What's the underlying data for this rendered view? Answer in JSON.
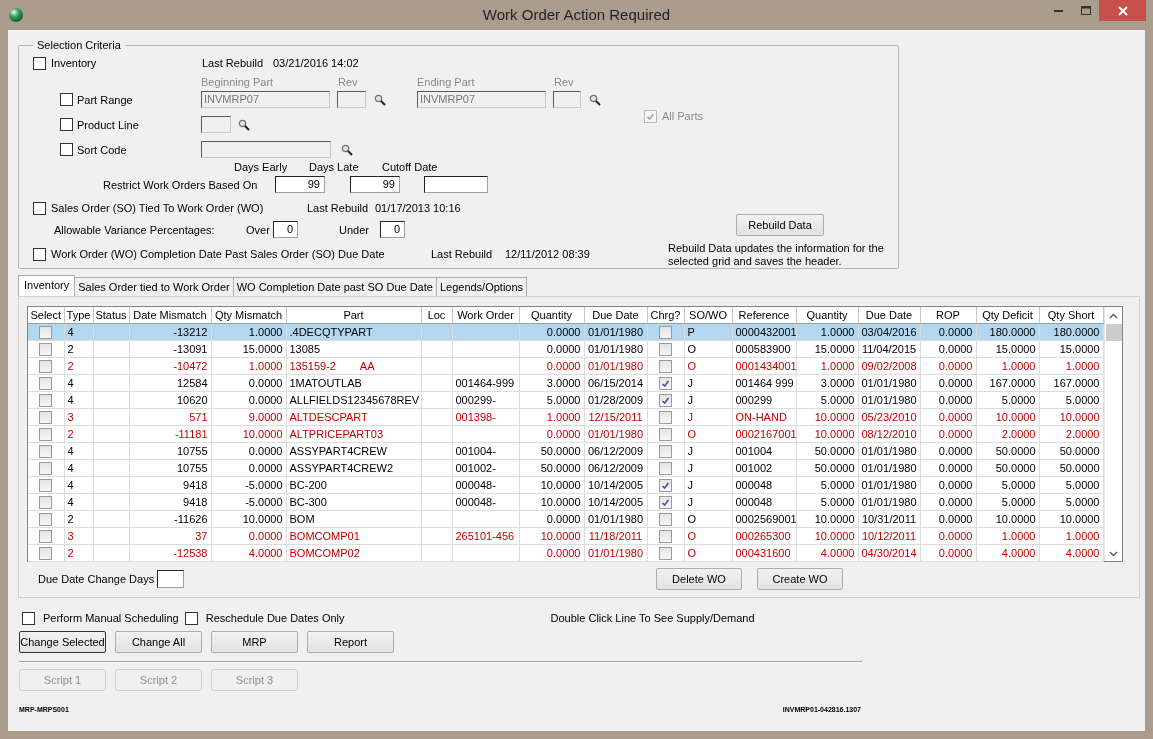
{
  "window": {
    "title": "Work Order Action Required"
  },
  "selection_criteria": {
    "title": "Selection Criteria",
    "inventory": {
      "label": "Inventory",
      "checked": false,
      "last_rebuild_label": "Last Rebuild",
      "last_rebuild": "03/21/2016 14:02"
    },
    "part_range": {
      "label": "Part Range",
      "checked": false,
      "disabled": true,
      "beginning_part_label": "Beginning Part",
      "beginning_part": "INVMRP07",
      "beginning_rev_label": "Rev",
      "ending_part_label": "Ending Part",
      "ending_part": "INVMRP07",
      "ending_rev_label": "Rev"
    },
    "all_parts": {
      "label": "All Parts",
      "checked": true,
      "disabled": true
    },
    "product_line": {
      "label": "Product Line",
      "checked": false
    },
    "sort_code": {
      "label": "Sort Code",
      "checked": false
    },
    "restrict": {
      "label": "Restrict Work Orders Based On",
      "days_early_label": "Days Early",
      "days_early": "99",
      "days_late_label": "Days Late",
      "days_late": "99",
      "cutoff_date_label": "Cutoff Date"
    },
    "sales_order": {
      "label": "Sales Order (SO) Tied To Work Order (WO)",
      "checked": false,
      "last_rebuild_label": "Last Rebuild",
      "last_rebuild": "01/17/2013 10:16"
    },
    "variance": {
      "label": "Allowable Variance Percentages:",
      "over_label": "Over",
      "over": "0",
      "under_label": "Under",
      "under": "0"
    },
    "completion": {
      "label": "Work Order (WO) Completion Date Past Sales Order (SO) Due Date",
      "checked": false,
      "last_rebuild_label": "Last Rebuild",
      "last_rebuild": "12/11/2012 08:39"
    },
    "rebuild_button": {
      "label": "Rebuild Data"
    },
    "rebuild_note": "Rebuild Data updates the information for the selected grid and saves the header."
  },
  "tabs": [
    {
      "label": "Inventory",
      "selected": true
    },
    {
      "label": "Sales Order tied to Work Order",
      "selected": false
    },
    {
      "label": "WO Completion Date past SO Due Date",
      "selected": false
    },
    {
      "label": "Legends/Options",
      "selected": false
    }
  ],
  "grid": {
    "columns": [
      {
        "label": "Select",
        "kind": "check"
      },
      {
        "label": "Type",
        "kind": "text"
      },
      {
        "label": "Status",
        "kind": "text"
      },
      {
        "label": "Date Mismatch",
        "kind": "number"
      },
      {
        "label": "Qty Mismatch",
        "kind": "number"
      },
      {
        "label": "Part",
        "kind": "text"
      },
      {
        "label": "Loc",
        "kind": "text"
      },
      {
        "label": "Work Order",
        "kind": "text"
      },
      {
        "label": "Quantity",
        "kind": "number"
      },
      {
        "label": "Due Date",
        "kind": "date"
      },
      {
        "label": "Chrg?",
        "kind": "check"
      },
      {
        "label": "SO/WO",
        "kind": "text"
      },
      {
        "label": "Reference",
        "kind": "text"
      },
      {
        "label": "Quantity",
        "kind": "number"
      },
      {
        "label": "Due Date",
        "kind": "date"
      },
      {
        "label": "ROP",
        "kind": "number"
      },
      {
        "label": "Qty Deficit",
        "kind": "number"
      },
      {
        "label": "Qty Short",
        "kind": "number"
      }
    ],
    "rows": [
      {
        "selected": true,
        "alert": false,
        "cells": [
          false,
          "4",
          "",
          "-13212",
          "1.0000",
          ".4DECQTYPART",
          "",
          "",
          "0.0000",
          "01/01/1980",
          false,
          "P",
          "0000432001",
          "1.0000",
          "03/04/2016",
          "0.0000",
          "180.0000",
          "180.0000"
        ]
      },
      {
        "selected": false,
        "alert": false,
        "cells": [
          false,
          "2",
          "",
          "-13091",
          "15.0000",
          "13085",
          "",
          "",
          "0.0000",
          "01/01/1980",
          false,
          "O",
          "000583900",
          "15.0000",
          "11/04/2015",
          "0.0000",
          "15.0000",
          "15.0000"
        ]
      },
      {
        "selected": false,
        "alert": true,
        "cells": [
          false,
          "2",
          "",
          "-10472",
          "1.0000",
          "135159-2        AA",
          "",
          "",
          "0.0000",
          "01/01/1980",
          false,
          "O",
          "0001434001",
          "1.0000",
          "09/02/2008",
          "0.0000",
          "1.0000",
          "1.0000"
        ]
      },
      {
        "selected": false,
        "alert": false,
        "cells": [
          false,
          "4",
          "",
          "12584",
          "0.0000",
          "1MATOUTLAB",
          "",
          "001464-999",
          "3.0000",
          "06/15/2014",
          true,
          "J",
          "001464 999",
          "3.0000",
          "01/01/1980",
          "0.0000",
          "167.0000",
          "167.0000"
        ]
      },
      {
        "selected": false,
        "alert": false,
        "cells": [
          false,
          "4",
          "",
          "10620",
          "0.0000",
          "ALLFIELDS12345678REV",
          "",
          "000299-",
          "5.0000",
          "01/28/2009",
          true,
          "J",
          "000299",
          "5.0000",
          "01/01/1980",
          "0.0000",
          "5.0000",
          "5.0000"
        ]
      },
      {
        "selected": false,
        "alert": true,
        "cells": [
          false,
          "3",
          "",
          "571",
          "9.0000",
          "ALTDESCPART",
          "",
          "001398-",
          "1.0000",
          "12/15/2011",
          false,
          "J",
          "ON-HAND",
          "10.0000",
          "05/23/2010",
          "0.0000",
          "10.0000",
          "10.0000"
        ]
      },
      {
        "selected": false,
        "alert": true,
        "cells": [
          false,
          "2",
          "",
          "-11181",
          "10.0000",
          "ALTPRICEPART03",
          "",
          "",
          "0.0000",
          "01/01/1980",
          false,
          "O",
          "0002167001",
          "10.0000",
          "08/12/2010",
          "0.0000",
          "2.0000",
          "2.0000"
        ]
      },
      {
        "selected": false,
        "alert": false,
        "cells": [
          false,
          "4",
          "",
          "10755",
          "0.0000",
          "ASSYPART4CREW",
          "",
          "001004-",
          "50.0000",
          "06/12/2009",
          false,
          "J",
          "001004",
          "50.0000",
          "01/01/1980",
          "0.0000",
          "50.0000",
          "50.0000"
        ]
      },
      {
        "selected": false,
        "alert": false,
        "cells": [
          false,
          "4",
          "",
          "10755",
          "0.0000",
          "ASSYPART4CREW2",
          "",
          "001002-",
          "50.0000",
          "06/12/2009",
          false,
          "J",
          "001002",
          "50.0000",
          "01/01/1980",
          "0.0000",
          "50.0000",
          "50.0000"
        ]
      },
      {
        "selected": false,
        "alert": false,
        "cells": [
          false,
          "4",
          "",
          "9418",
          "-5.0000",
          "BC-200",
          "",
          "000048-",
          "10.0000",
          "10/14/2005",
          true,
          "J",
          "000048",
          "5.0000",
          "01/01/1980",
          "0.0000",
          "5.0000",
          "5.0000"
        ]
      },
      {
        "selected": false,
        "alert": false,
        "cells": [
          false,
          "4",
          "",
          "9418",
          "-5.0000",
          "BC-300",
          "",
          "000048-",
          "10.0000",
          "10/14/2005",
          true,
          "J",
          "000048",
          "5.0000",
          "01/01/1980",
          "0.0000",
          "5.0000",
          "5.0000"
        ]
      },
      {
        "selected": false,
        "alert": false,
        "cells": [
          false,
          "2",
          "",
          "-11626",
          "10.0000",
          "BOM",
          "",
          "",
          "0.0000",
          "01/01/1980",
          false,
          "O",
          "0002569001",
          "10.0000",
          "10/31/2011",
          "0.0000",
          "10.0000",
          "10.0000"
        ]
      },
      {
        "selected": false,
        "alert": true,
        "cells": [
          false,
          "3",
          "",
          "37",
          "0.0000",
          "BOMCOMP01",
          "",
          "265101-456",
          "10.0000",
          "11/18/2011",
          false,
          "O",
          "000265300",
          "10.0000",
          "10/12/2011",
          "0.0000",
          "1.0000",
          "1.0000"
        ]
      },
      {
        "selected": false,
        "alert": true,
        "cells": [
          false,
          "2",
          "",
          "-12538",
          "4.0000",
          "BOMCOMP02",
          "",
          "",
          "0.0000",
          "01/01/1980",
          false,
          "O",
          "000431600",
          "4.0000",
          "04/30/2014",
          "0.0000",
          "4.0000",
          "4.0000"
        ]
      }
    ]
  },
  "due_date_change": {
    "label": "Due Date Change Days"
  },
  "grid_buttons": [
    {
      "label": "Delete WO"
    },
    {
      "label": "Create WO"
    }
  ],
  "options": [
    {
      "label": "Perform Manual Scheduling",
      "checked": false
    },
    {
      "label": "Reschedule Due Dates Only",
      "checked": false
    }
  ],
  "hint": "Double Click Line To See Supply/Demand",
  "actions": [
    {
      "label": "Change Selected",
      "focused": true
    },
    {
      "label": "Change All",
      "focused": false
    },
    {
      "label": "MRP",
      "focused": false
    },
    {
      "label": "Report",
      "focused": false
    }
  ],
  "scripts": [
    {
      "label": "Script 1",
      "disabled": true
    },
    {
      "label": "Script 2",
      "disabled": true
    },
    {
      "label": "Script 3",
      "disabled": true
    }
  ],
  "status_bar": {
    "left": "MRP-MRPS001",
    "right": "INVMRP01-042816.1307"
  }
}
